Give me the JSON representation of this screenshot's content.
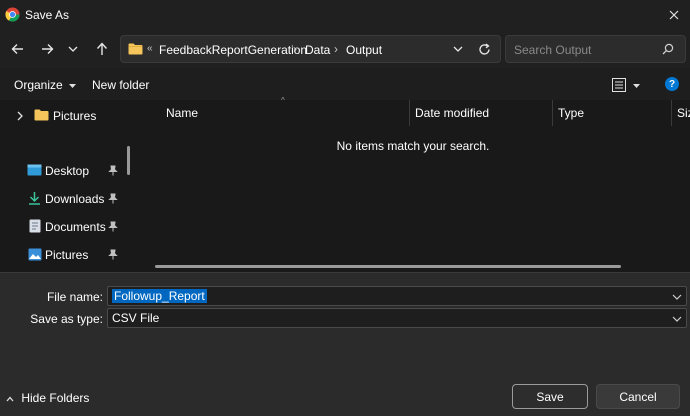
{
  "window": {
    "title": "Save As",
    "close_glyph": "✕"
  },
  "nav": {
    "back_icon": "arrow-left",
    "forward_icon": "arrow-right",
    "recent_icon": "chevron-down",
    "up_icon": "arrow-up",
    "breadcrumb_overflow": "«",
    "breadcrumbs": [
      "FeedbackReportGeneration",
      "Data",
      "Output"
    ],
    "search_placeholder": "Search Output"
  },
  "toolbar": {
    "organize": "Organize",
    "new_folder": "New folder",
    "help": "?"
  },
  "sidebar": {
    "items": [
      {
        "label": "Pictures",
        "icon": "folder-icon",
        "expander": true
      },
      {
        "label": "Desktop",
        "icon": "desktop-icon",
        "pinned": true
      },
      {
        "label": "Downloads",
        "icon": "download-icon",
        "pinned": true
      },
      {
        "label": "Documents",
        "icon": "documents-icon",
        "pinned": true
      },
      {
        "label": "Pictures",
        "icon": "pictures-icon",
        "pinned": true
      }
    ]
  },
  "columns": [
    "Name",
    "Date modified",
    "Type",
    "Size"
  ],
  "empty_message": "No items match your search.",
  "form": {
    "file_name_label": "File name:",
    "file_name_value": "Followup_Report",
    "save_type_label": "Save as type:",
    "save_type_value": "CSV File"
  },
  "footer": {
    "hide_folders": "Hide Folders",
    "save": "Save",
    "cancel": "Cancel"
  },
  "colors": {
    "accent": "#0067c0",
    "folder": "#f5c55b",
    "background": "#1c1c1c"
  }
}
